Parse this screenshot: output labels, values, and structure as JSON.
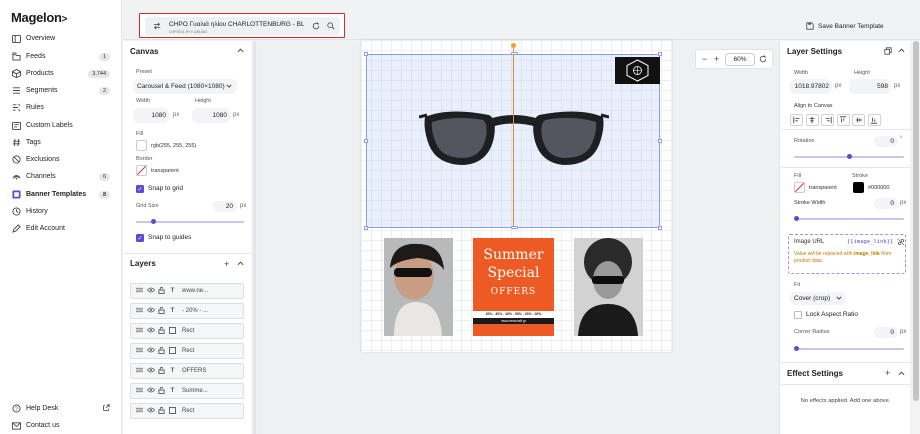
{
  "brand": "Magelon",
  "nav": {
    "items": [
      {
        "label": "Overview",
        "icon": "overview-icon",
        "badge": ""
      },
      {
        "label": "Feeds",
        "icon": "feeds-icon",
        "badge": "1"
      },
      {
        "label": "Products",
        "icon": "products-icon",
        "badge": "3,744"
      },
      {
        "label": "Segments",
        "icon": "segments-icon",
        "badge": "2"
      },
      {
        "label": "Rules",
        "icon": "rules-icon",
        "badge": ""
      },
      {
        "label": "Custom Labels",
        "icon": "labels-icon",
        "badge": ""
      },
      {
        "label": "Tags",
        "icon": "hash-icon",
        "badge": ""
      },
      {
        "label": "Exclusions",
        "icon": "exclusions-icon",
        "badge": ""
      },
      {
        "label": "Channels",
        "icon": "channels-icon",
        "badge": "6"
      },
      {
        "label": "Banner Templates",
        "icon": "banner-icon",
        "badge": "8"
      },
      {
        "label": "History",
        "icon": "history-icon",
        "badge": ""
      },
      {
        "label": "Edit Account",
        "icon": "edit-icon",
        "badge": ""
      }
    ],
    "help": "Help Desk",
    "contact": "Contact us"
  },
  "topbar": {
    "product_title": "CHPO Γυαλιά ηλίου CHARLOTTENBURG - BLA...",
    "product_sub": "CHP2101 HYY-326-683",
    "save_label": "Save Banner Template"
  },
  "canvas_panel": {
    "title": "Canvas",
    "preset_label": "Preset",
    "preset_value": "Carousel & Feed (1080×1080)",
    "width_label": "Width",
    "width_value": "1080",
    "height_label": "Height",
    "height_value": "1080",
    "unit": "px",
    "fill_label": "Fill",
    "fill_value": "rgb(255, 255, 255)",
    "border_label": "Border",
    "border_value": "transparent",
    "snap_grid": "Snap to grid",
    "grid_size_label": "Grid Size",
    "grid_size_value": "20",
    "snap_guides": "Snap to guides",
    "grid_size_level": 0.15
  },
  "layers": {
    "title": "Layers",
    "items": [
      {
        "type": "T",
        "name": "www.ne..."
      },
      {
        "type": "T",
        "name": "- 20% - ..."
      },
      {
        "type": "R",
        "name": "Rect"
      },
      {
        "type": "R",
        "name": "Rect"
      },
      {
        "type": "T",
        "name": "OFFERS"
      },
      {
        "type": "T",
        "name": "Summe..."
      },
      {
        "type": "R",
        "name": "Rect"
      }
    ]
  },
  "canvas_art": {
    "promo_line1": "Summer",
    "promo_line2": "Special",
    "promo_line3": "OFFERS",
    "promo_strip": "20% - 30% - 40% - 50% - 20% - 40%",
    "promo_url": "www.newcraft.gr"
  },
  "zoom": {
    "value": "60%",
    "minus": "−",
    "plus": "+"
  },
  "layer_settings": {
    "title": "Layer Settings",
    "width_label": "Width",
    "width_value": "1018.97802",
    "height_label": "Height",
    "height_value": "598",
    "unit": "px",
    "align_label": "Align to Canvas",
    "rotation_label": "Rotation",
    "rotation_value": "0",
    "rotation_unit": "°",
    "rotation_level": 0.5,
    "fill_label": "Fill",
    "fill_value": "transparent",
    "stroke_label": "Stroke",
    "stroke_value": "#000000",
    "stroke_width_label": "Stroke Width",
    "stroke_width_value": "0",
    "stroke_width_level": 0.0,
    "image_url_label": "Image URL",
    "image_url_tag": "{{image_link}}",
    "image_url_note_pre": "Value will be replaced with ",
    "image_url_note_key": "image_link",
    "image_url_note_post": " from product data.",
    "fit_label": "Fit",
    "fit_value": "Cover (crop)",
    "lock_aspect": "Lock Aspect Ratio",
    "corner_label": "Corner Radius",
    "corner_value": "0",
    "corner_level": 0.0
  },
  "effect_settings": {
    "title": "Effect Settings",
    "empty": "No effects applied. Add one above."
  },
  "colors": {
    "accent": "#5b4ccf",
    "promo_bg": "#ee5a24",
    "highlight": "#d72b2b"
  }
}
